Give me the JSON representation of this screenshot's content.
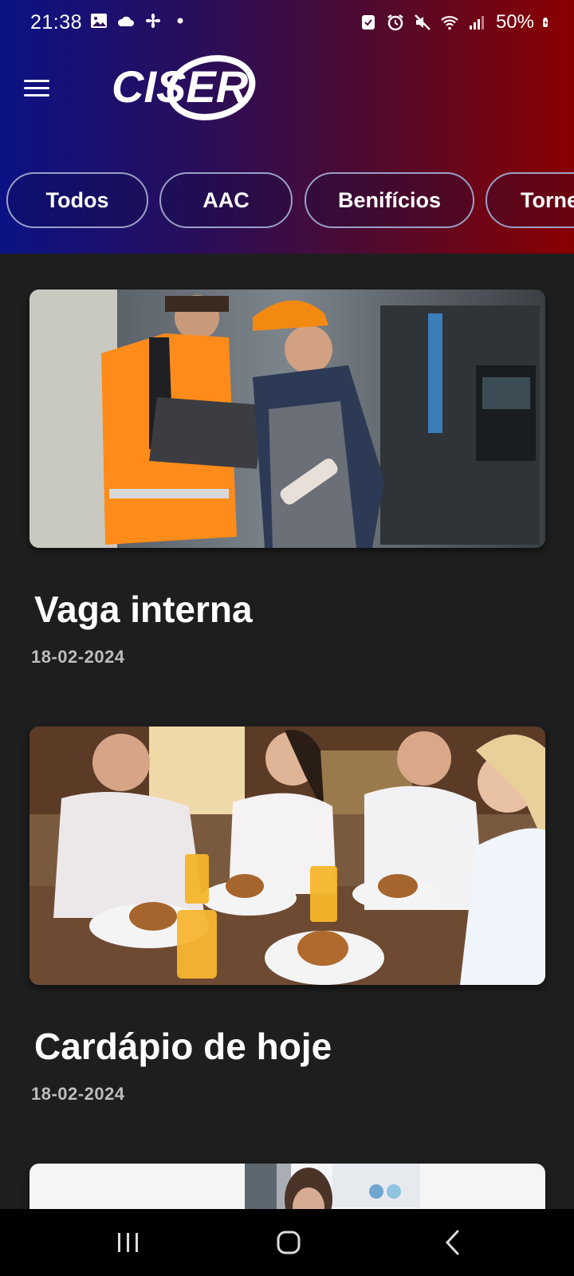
{
  "status_bar": {
    "time": "21:38",
    "battery": "50%",
    "left_icons": [
      "gallery-icon",
      "cloud-icon",
      "fan-icon",
      "dot-icon"
    ],
    "right_icons": [
      "screenshot-icon",
      "alarm-icon",
      "mute-icon",
      "wifi-icon",
      "signal-icon",
      "battery-icon"
    ]
  },
  "app_bar": {
    "menu_icon": "hamburger-menu-icon",
    "logo_text": "CISER"
  },
  "categories": [
    {
      "label": "Todos"
    },
    {
      "label": "AAC"
    },
    {
      "label": "Benifícios"
    },
    {
      "label": "Torne"
    }
  ],
  "feed": [
    {
      "title": "Vaga interna",
      "date": "18-02-2024",
      "image": "industrial-workers-with-laptop-photo"
    },
    {
      "title": "Cardápio de hoje",
      "date": "18-02-2024",
      "image": "people-eating-burgers-photo"
    },
    {
      "image": "woman-at-office-photo"
    }
  ],
  "nav_bar": {
    "recents_icon": "recents-icon",
    "home_icon": "home-icon",
    "back_icon": "back-icon"
  },
  "colors": {
    "header_gradient_start": "#0b1285",
    "header_gradient_end": "#8a0000",
    "background": "#1e1e1e",
    "chip_border": "#9aa0c8",
    "date_text": "#bdbdbd"
  }
}
